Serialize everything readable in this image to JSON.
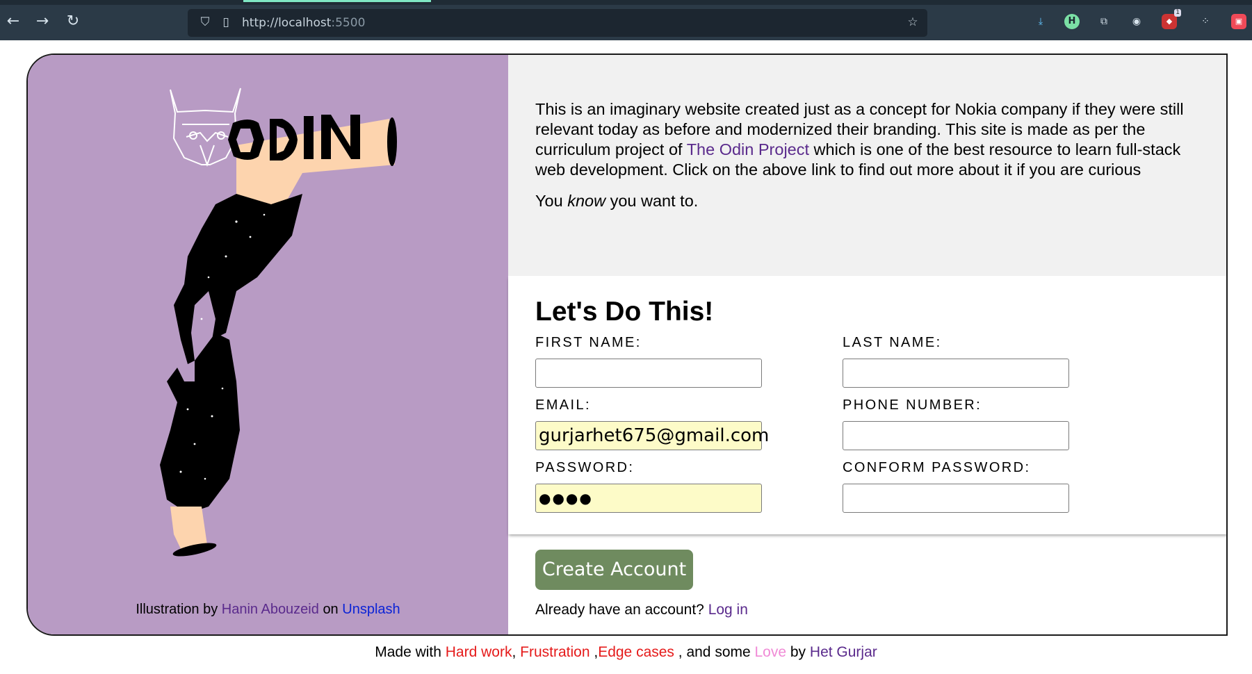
{
  "browser": {
    "url_host": "http://localhost",
    "url_port": ":5500",
    "nav": {
      "back_icon": "←",
      "forward_icon": "→",
      "reload_icon": "↻"
    },
    "extension_badge": "1"
  },
  "illustration": {
    "logo_text": "ODIN"
  },
  "credit": {
    "prefix": "Illustration by",
    "author": "Hanin Abouzeid",
    "middle": "on",
    "site": "Unsplash"
  },
  "intro": {
    "p1_before": "This is an imaginary website created just as a concept for Nokia company if they were still relevant today as before and modernized their branding. This site is made as per the curriculum project of ",
    "p1_link": "The Odin Project",
    "p1_after": " which is one of the best resource to learn full-stack web development. Click on the above link to find out more about it if you are curious",
    "p2_before": "You ",
    "p2_em": "know",
    "p2_after": " you want to."
  },
  "form": {
    "title": "Let's Do This!",
    "fields": [
      {
        "label": "FIRST NAME:",
        "value": ""
      },
      {
        "label": "LAST NAME:",
        "value": ""
      },
      {
        "label": "EMAIL:",
        "value": "gurjarhet675@gmail.com"
      },
      {
        "label": "PHONE NUMBER:",
        "value": ""
      },
      {
        "label": "PASSWORD:",
        "value": "●●●●"
      },
      {
        "label": "CONFORM PASSWORD:",
        "value": ""
      }
    ],
    "submit_label": "Create Account",
    "login_prompt": "Already have an account?",
    "login_link": "Log in"
  },
  "footer": {
    "t1": "Made with ",
    "hard": "Hard work",
    "t2": ", ",
    "frust": "Frustration",
    "t3": " ,",
    "edge": "Edge cases",
    "t4": " , and some ",
    "love": "Love",
    "t5": " by ",
    "author": "Het Gurjar"
  },
  "colors": {
    "panel_purple": "#b89bc4",
    "button_green": "#6f8b5f",
    "autofill_yellow": "#fdfbc8",
    "link_purple": "#5a2a8c"
  }
}
